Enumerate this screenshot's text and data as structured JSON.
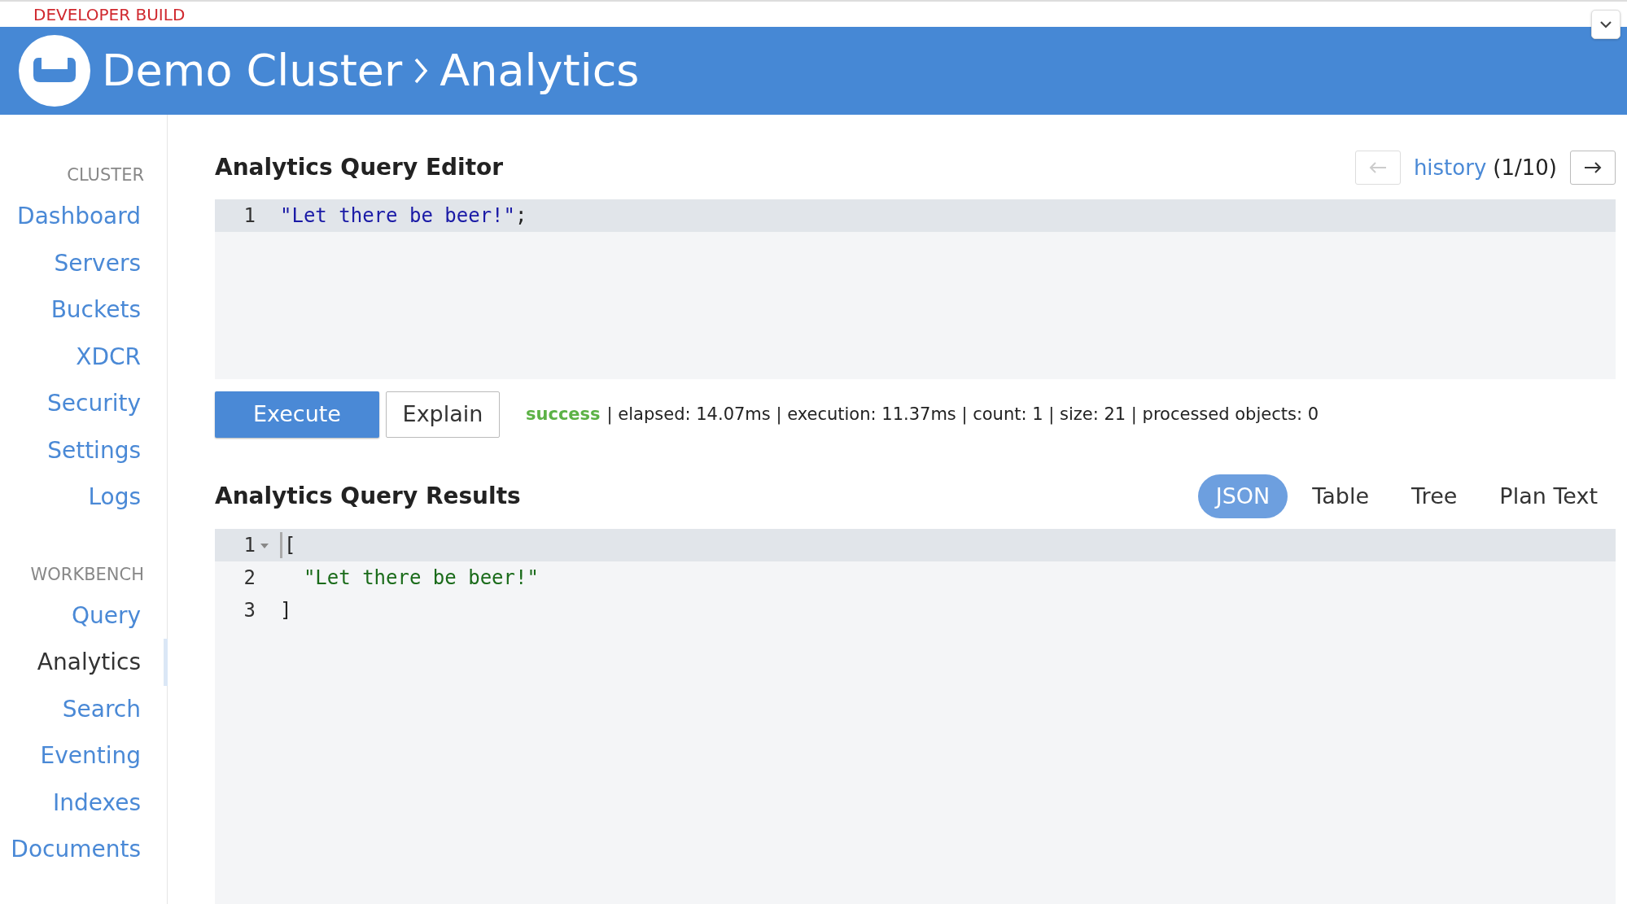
{
  "build_banner": "DEVELOPER BUILD",
  "header": {
    "cluster": "Demo Cluster",
    "page": "Analytics"
  },
  "sidebar": {
    "sections": [
      {
        "label": "CLUSTER",
        "items": [
          {
            "label": "Dashboard",
            "selected": false
          },
          {
            "label": "Servers",
            "selected": false
          },
          {
            "label": "Buckets",
            "selected": false
          },
          {
            "label": "XDCR",
            "selected": false
          },
          {
            "label": "Security",
            "selected": false
          },
          {
            "label": "Settings",
            "selected": false
          },
          {
            "label": "Logs",
            "selected": false
          }
        ]
      },
      {
        "label": "WORKBENCH",
        "items": [
          {
            "label": "Query",
            "selected": false
          },
          {
            "label": "Analytics",
            "selected": true
          },
          {
            "label": "Search",
            "selected": false
          },
          {
            "label": "Eventing",
            "selected": false
          },
          {
            "label": "Indexes",
            "selected": false
          },
          {
            "label": "Documents",
            "selected": false
          }
        ]
      }
    ]
  },
  "editor": {
    "title": "Analytics Query Editor",
    "history": {
      "link": "history",
      "position": "(1/10)",
      "previous_disabled": true,
      "next_disabled": false
    },
    "lines": [
      {
        "number": "1",
        "active": true,
        "foldable": false,
        "tokens": [
          {
            "kind": "string",
            "text": "\"Let there be beer!\""
          },
          {
            "kind": "punct",
            "text": ";"
          }
        ]
      }
    ]
  },
  "actions": [
    {
      "label": "Execute",
      "kind": "primary"
    },
    {
      "label": "Explain",
      "kind": "outline"
    }
  ],
  "status": {
    "result": "success",
    "details": "| elapsed: 14.07ms | execution: 11.37ms | count: 1 | size: 21 | processed objects: 0"
  },
  "results": {
    "title": "Analytics Query Results",
    "views": [
      {
        "label": "JSON",
        "selected": true
      },
      {
        "label": "Table",
        "selected": false
      },
      {
        "label": "Tree",
        "selected": false
      },
      {
        "label": "Plan Text",
        "selected": false
      }
    ],
    "lines": [
      {
        "number": "1",
        "active": true,
        "foldable": true,
        "cursor": true,
        "tokens": [
          {
            "kind": "punct",
            "text": "["
          }
        ]
      },
      {
        "number": "2",
        "active": false,
        "foldable": false,
        "tokens": [
          {
            "kind": "json-string",
            "text": "  \"Let there be beer!\""
          }
        ]
      },
      {
        "number": "3",
        "active": false,
        "foldable": false,
        "tokens": [
          {
            "kind": "punct",
            "text": "]"
          }
        ]
      }
    ]
  }
}
